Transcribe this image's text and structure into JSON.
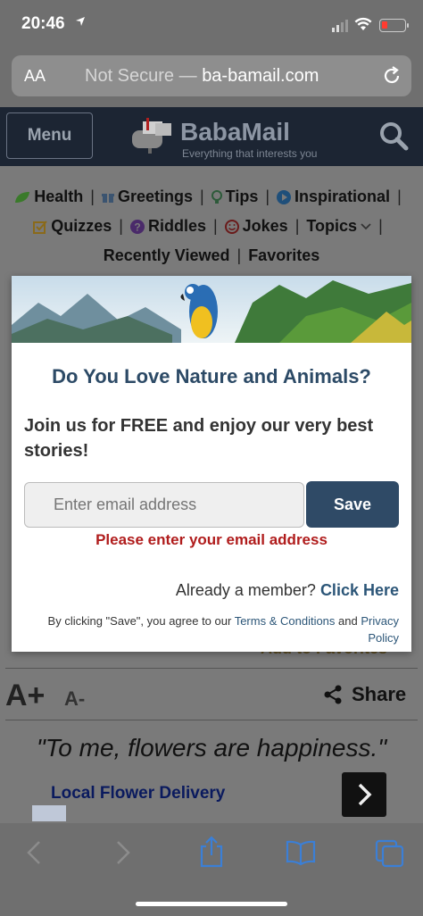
{
  "status_bar": {
    "time": "20:46"
  },
  "address_bar": {
    "text_size": "AA",
    "not_secure": "Not Secure",
    "separator": "—",
    "domain": "ba-bamail.com"
  },
  "header": {
    "menu_label": "Menu",
    "logo_name": "BabaMail",
    "logo_tagline": "Everything that interests you"
  },
  "nav": {
    "row1": [
      "Health",
      "Greetings",
      "Tips",
      "Inspirational"
    ],
    "row2": [
      "Quizzes",
      "Riddles",
      "Jokes",
      "Topics"
    ],
    "row3": [
      "Recently Viewed",
      "Favorites"
    ]
  },
  "page": {
    "font_larger": "A+",
    "font_smaller": "A-",
    "share_label": "Share",
    "quote": "\"To me, flowers are happiness.\"",
    "ad_link": "Local Flower Delivery",
    "fav_peek": "Add to Favorites"
  },
  "modal": {
    "title": "Do You Love Nature and Animals?",
    "subtitle": "Join us for FREE and enjoy our very best stories!",
    "email_placeholder": "Enter email address",
    "save_label": "Save",
    "error": "Please enter your email address",
    "member_text": "Already a member?",
    "member_link": "Click Here",
    "legal_prefix": "By clicking \"Save\", you agree to our",
    "terms_link": "Terms & Conditions",
    "legal_and": "and",
    "privacy_link": "Privacy Policy"
  },
  "colors": {
    "header_bg": "#1c2533",
    "modal_title": "#2c4a66",
    "save_bg": "#2f4a66",
    "error": "#b01c1c",
    "toolbar_icon": "#3b7fd6"
  },
  "icons": [
    "location-arrow-icon",
    "signal-icon",
    "wifi-icon",
    "battery-icon",
    "reload-icon",
    "search-icon",
    "leaf-icon",
    "gift-icon",
    "lightbulb-icon",
    "play-icon",
    "check-icon",
    "question-icon",
    "smile-icon",
    "chevron-down-icon",
    "share-icon",
    "chevron-right-icon",
    "back-icon",
    "forward-icon",
    "share-sheet-icon",
    "bookmarks-icon",
    "tabs-icon"
  ]
}
